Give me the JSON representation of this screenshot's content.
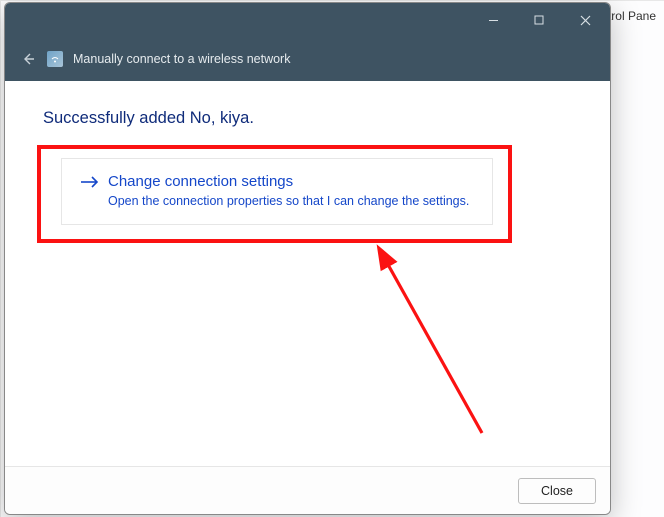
{
  "background": {
    "partial_text": "ntrol Pane"
  },
  "titlebar": {
    "minimize_label": "Minimize",
    "maximize_label": "Maximize",
    "close_label": "Close"
  },
  "header": {
    "title": "Manually connect to a wireless network"
  },
  "content": {
    "success_message": "Successfully added No, kiya.",
    "option": {
      "title": "Change connection settings",
      "description": "Open the connection properties so that I can change the settings."
    }
  },
  "footer": {
    "close_button": "Close"
  },
  "annotation": {
    "highlight_color": "#fb1212"
  }
}
